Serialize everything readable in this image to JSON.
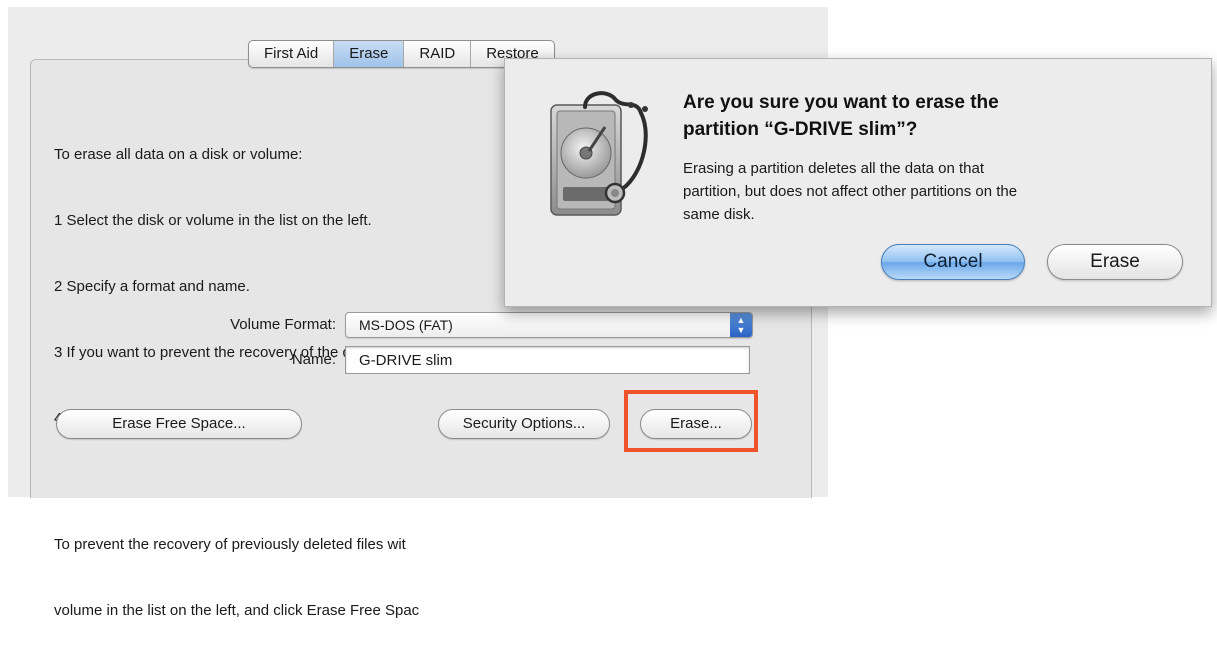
{
  "tabs": [
    {
      "label": "First Aid",
      "selected": false
    },
    {
      "label": "Erase",
      "selected": true
    },
    {
      "label": "RAID",
      "selected": false
    },
    {
      "label": "Restore",
      "selected": false
    }
  ],
  "instructions": {
    "erase_lines": [
      "To erase all data on a disk or volume:",
      "1 Select the disk or volume in the list on the left.",
      "2 Specify a format and name.",
      "3 If you want to prevent the recovery of the disk’s era",
      "4 Click Erase."
    ],
    "free_space_lines": [
      "To prevent the recovery of previously deleted files wit",
      "volume in the list on the left, and click Erase Free Spac"
    ]
  },
  "form": {
    "volume_format_label": "Volume Format:",
    "volume_format_value": "MS-DOS (FAT)",
    "name_label": "Name:",
    "name_value": "G-DRIVE slim"
  },
  "buttons": {
    "erase_free_space": "Erase Free Space...",
    "security_options": "Security Options...",
    "erase": "Erase..."
  },
  "alert": {
    "title_lines": [
      "Are you sure you want to erase the",
      "partition “G-DRIVE slim”?"
    ],
    "message_lines": [
      "Erasing a partition deletes all the data on that",
      "partition, but does not affect other partitions on the",
      "same disk."
    ],
    "cancel_label": "Cancel",
    "erase_label": "Erase",
    "icon": "disk-utility-icon"
  },
  "colors": {
    "highlight": "#f0532a",
    "selected_tab": "#9fc3ea",
    "default_button": "#6aa8ea"
  }
}
